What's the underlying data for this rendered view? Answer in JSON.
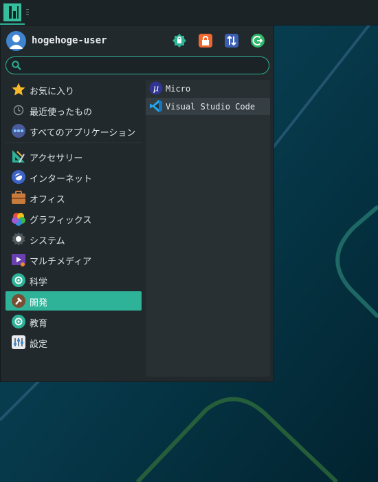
{
  "user": {
    "name": "hogehoge-user"
  },
  "actions": [
    {
      "name": "lock-screen-icon"
    },
    {
      "name": "lock-icon"
    },
    {
      "name": "switch-user-icon"
    },
    {
      "name": "logout-icon"
    }
  ],
  "search": {
    "value": "",
    "placeholder": ""
  },
  "categories": [
    {
      "label": "お気に入り",
      "icon": "star-icon"
    },
    {
      "label": "最近使ったもの",
      "icon": "clock-icon"
    },
    {
      "label": "すべてのアプリケーション",
      "icon": "all-apps-icon"
    },
    {
      "label": "アクセサリー",
      "icon": "accessories-icon"
    },
    {
      "label": "インターネット",
      "icon": "internet-icon"
    },
    {
      "label": "オフィス",
      "icon": "office-icon"
    },
    {
      "label": "グラフィックス",
      "icon": "graphics-icon"
    },
    {
      "label": "システム",
      "icon": "system-icon"
    },
    {
      "label": "マルチメディア",
      "icon": "multimedia-icon"
    },
    {
      "label": "科学",
      "icon": "science-icon"
    },
    {
      "label": "開発",
      "icon": "development-icon",
      "selected": true
    },
    {
      "label": "教育",
      "icon": "education-icon"
    },
    {
      "label": "設定",
      "icon": "settings-icon"
    }
  ],
  "apps": [
    {
      "label": "Micro",
      "icon": "micro-icon"
    },
    {
      "label": "Visual Studio Code",
      "icon": "vscode-icon",
      "hover": true
    }
  ],
  "colors": {
    "accent": "#2eb398",
    "panel": "#22292c",
    "desktop": "#063a4c"
  }
}
